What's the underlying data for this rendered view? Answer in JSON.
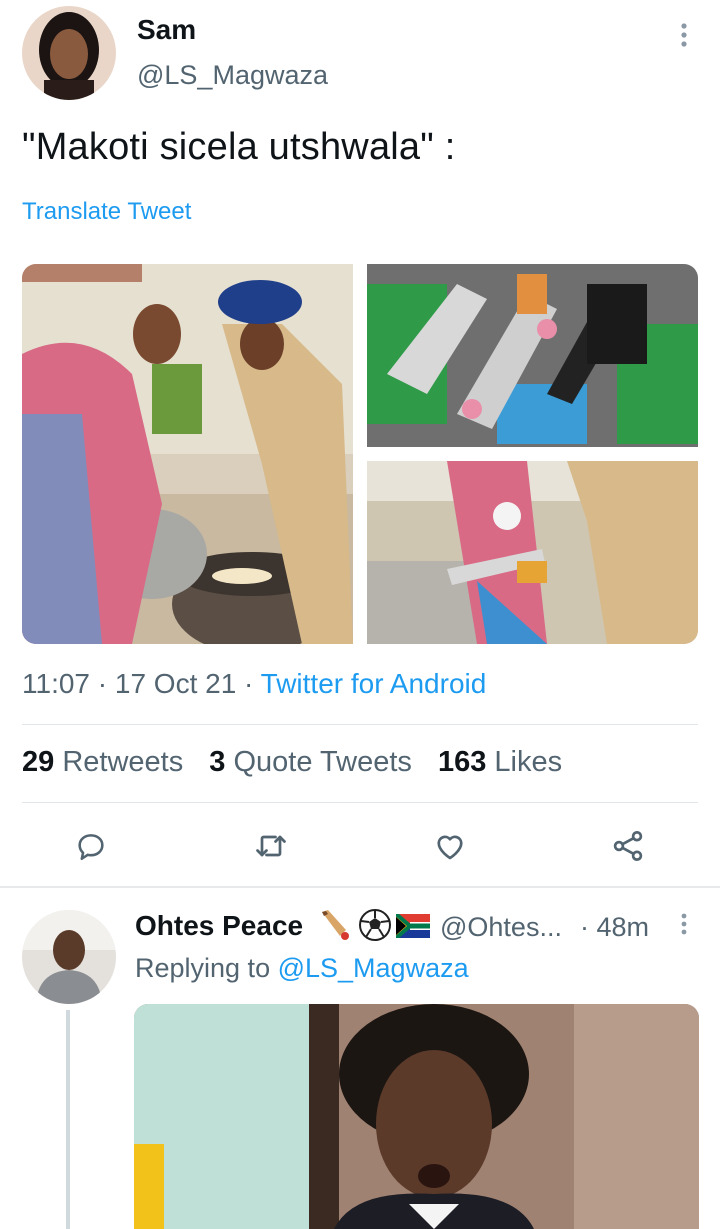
{
  "tweet": {
    "author_name": "Sam",
    "author_handle": "@LS_Magwaza",
    "text": "\"Makoti sicela utshwala\" :",
    "translate_label": "Translate Tweet",
    "time": "11:07 · 17 Oct 21 · ",
    "client": "Twitter for Android",
    "stats": {
      "retweets_count": "29",
      "retweets_label": "Retweets",
      "quotes_count": "3",
      "quotes_label": "Quote Tweets",
      "likes_count": "163",
      "likes_label": "Likes"
    },
    "media": [
      {
        "icon": "photo-women-cooking"
      },
      {
        "icon": "photo-bottles-in-ice"
      },
      {
        "icon": "photo-pouring-bottle"
      }
    ]
  },
  "actions": [
    "reply-icon",
    "retweet-icon",
    "like-icon",
    "share-icon"
  ],
  "reply": {
    "author_name": "Ohtes Peace",
    "emojis": [
      "cricket-bat-icon",
      "soccer-ball-icon",
      "south-africa-flag-icon"
    ],
    "author_handle": "@Ohtes...",
    "time": "· 48m",
    "replying_prefix": "Replying to ",
    "replying_to": "@LS_Magwaza",
    "media_icon": "photo-surprised-man"
  },
  "colors": {
    "accent": "#1d9bf0",
    "secondary_text": "#536471",
    "primary_text": "#0f1419"
  }
}
